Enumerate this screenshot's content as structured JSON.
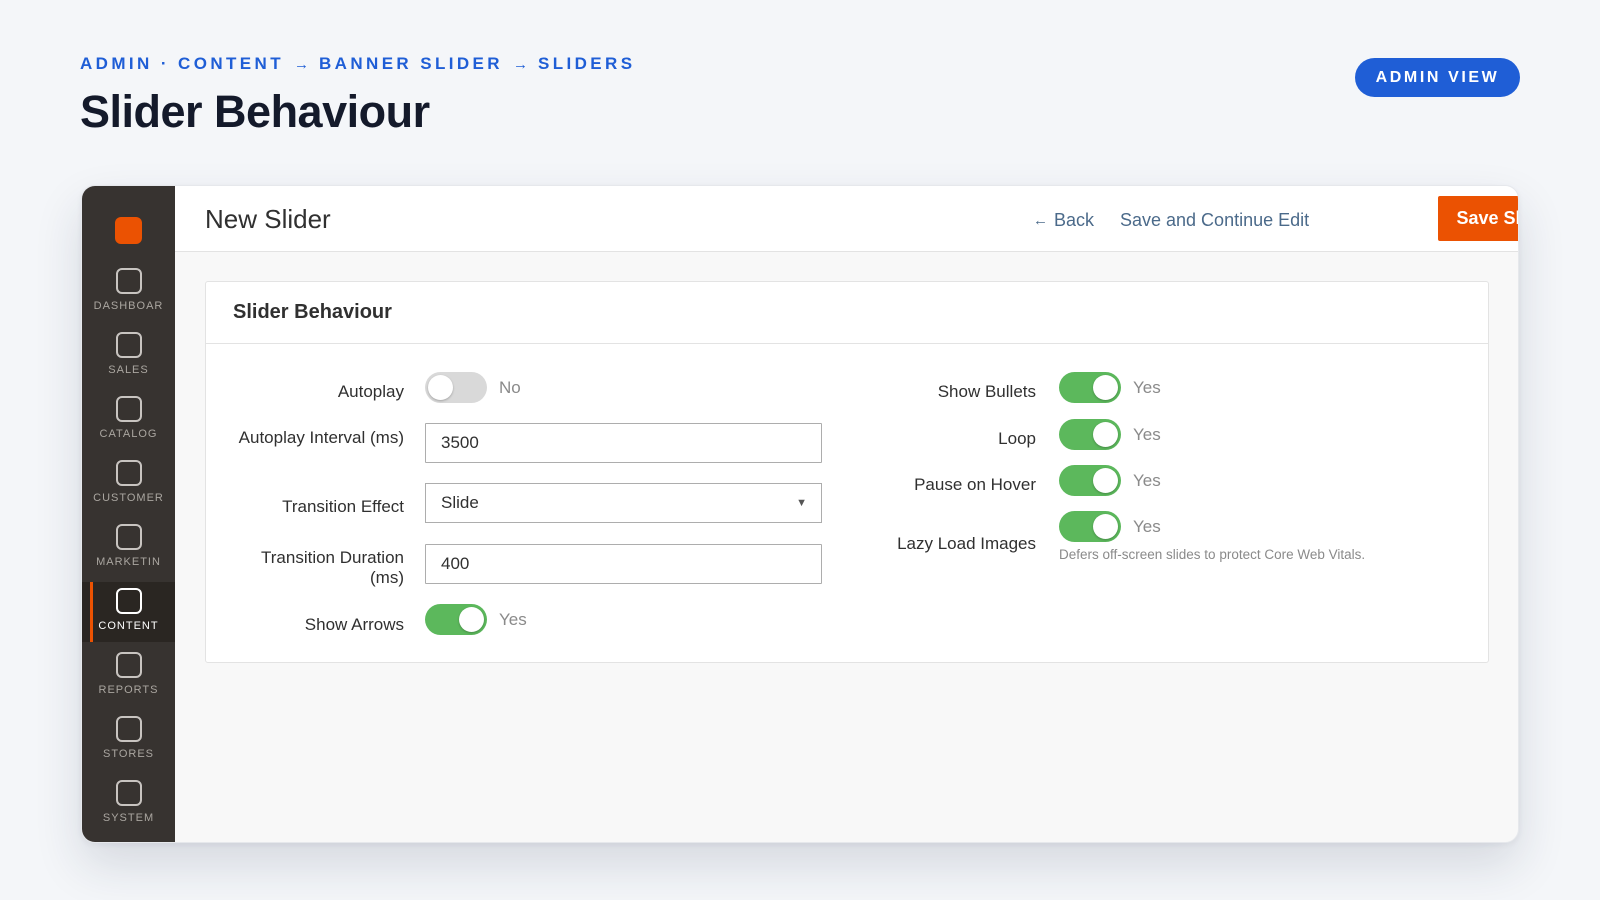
{
  "header": {
    "breadcrumb": [
      "ADMIN · CONTENT",
      "BANNER SLIDER",
      "SLIDERS"
    ],
    "breadcrumb_separator": "→",
    "title": "Slider Behaviour",
    "badge": "ADMIN VIEW"
  },
  "sidebar": {
    "items": [
      {
        "label": "DASHBOAR",
        "icon": "dashboard-icon"
      },
      {
        "label": "SALES",
        "icon": "sales-icon"
      },
      {
        "label": "CATALOG",
        "icon": "catalog-icon"
      },
      {
        "label": "CUSTOMER",
        "icon": "customer-icon"
      },
      {
        "label": "MARKETIN",
        "icon": "marketing-icon"
      },
      {
        "label": "CONTENT",
        "icon": "content-icon",
        "active": true
      },
      {
        "label": "REPORTS",
        "icon": "reports-icon"
      },
      {
        "label": "STORES",
        "icon": "stores-icon"
      },
      {
        "label": "SYSTEM",
        "icon": "system-icon"
      }
    ]
  },
  "topbar": {
    "title": "New Slider",
    "back_arrow": "←",
    "back_label": "Back",
    "save_continue_label": "Save and Continue Edit",
    "save_label": "Save Slider"
  },
  "form": {
    "section_title": "Slider Behaviour",
    "left": {
      "autoplay": {
        "label": "Autoplay",
        "value": false,
        "state": "No"
      },
      "autoplay_interval": {
        "label": "Autoplay Interval (ms)",
        "value": "3500"
      },
      "transition_effect": {
        "label": "Transition Effect",
        "value": "Slide"
      },
      "transition_duration": {
        "label": "Transition Duration (ms)",
        "value": "400"
      },
      "show_arrows": {
        "label": "Show Arrows",
        "value": true,
        "state": "Yes"
      }
    },
    "right": {
      "show_bullets": {
        "label": "Show Bullets",
        "value": true,
        "state": "Yes"
      },
      "loop": {
        "label": "Loop",
        "value": true,
        "state": "Yes"
      },
      "pause_on_hover": {
        "label": "Pause on Hover",
        "value": true,
        "state": "Yes"
      },
      "lazy_load": {
        "label": "Lazy Load Images",
        "value": true,
        "state": "Yes",
        "hint": "Defers off-screen slides to protect Core Web Vitals."
      }
    }
  },
  "colors": {
    "brand_blue": "#1f5ed6",
    "accent_orange": "#eb5202",
    "toggle_on": "#5cb85c",
    "sidebar_bg": "#373330"
  }
}
